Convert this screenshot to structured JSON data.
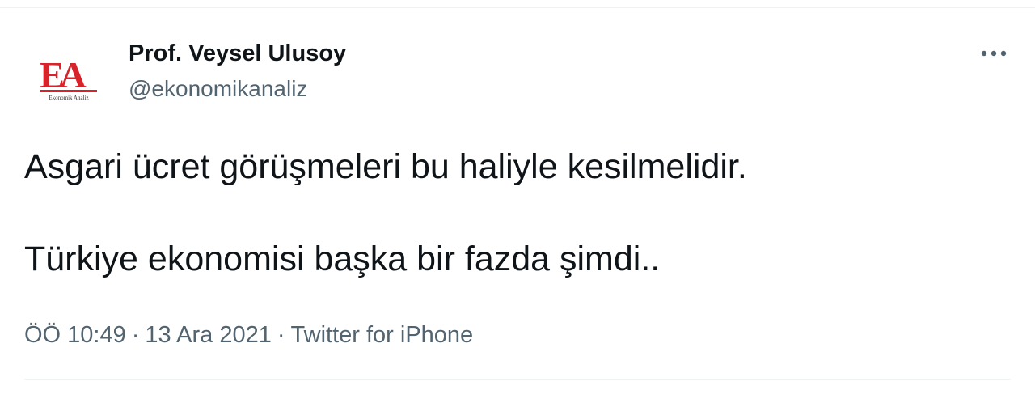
{
  "tweet": {
    "author": {
      "display_name": "Prof. Veysel Ulusoy",
      "handle": "@ekonomikanaliz",
      "avatar": {
        "logo_text": "EA",
        "logo_caption": "Ekonomik Analiz",
        "logo_color": "#d8232a"
      }
    },
    "more_icon": "more-horizontal-icon",
    "text_lines": [
      "Asgari ücret görüşmeleri bu haliyle kesilmelidir.",
      "Türkiye ekonomisi başka bir fazda şimdi.."
    ],
    "meta": {
      "time": "ÖÖ 10:49",
      "date": "13 Ara 2021",
      "separator": "·",
      "source": "Twitter for iPhone"
    }
  },
  "colors": {
    "text_primary": "#0f1419",
    "text_secondary": "#536471",
    "divider": "#eff3f4"
  }
}
